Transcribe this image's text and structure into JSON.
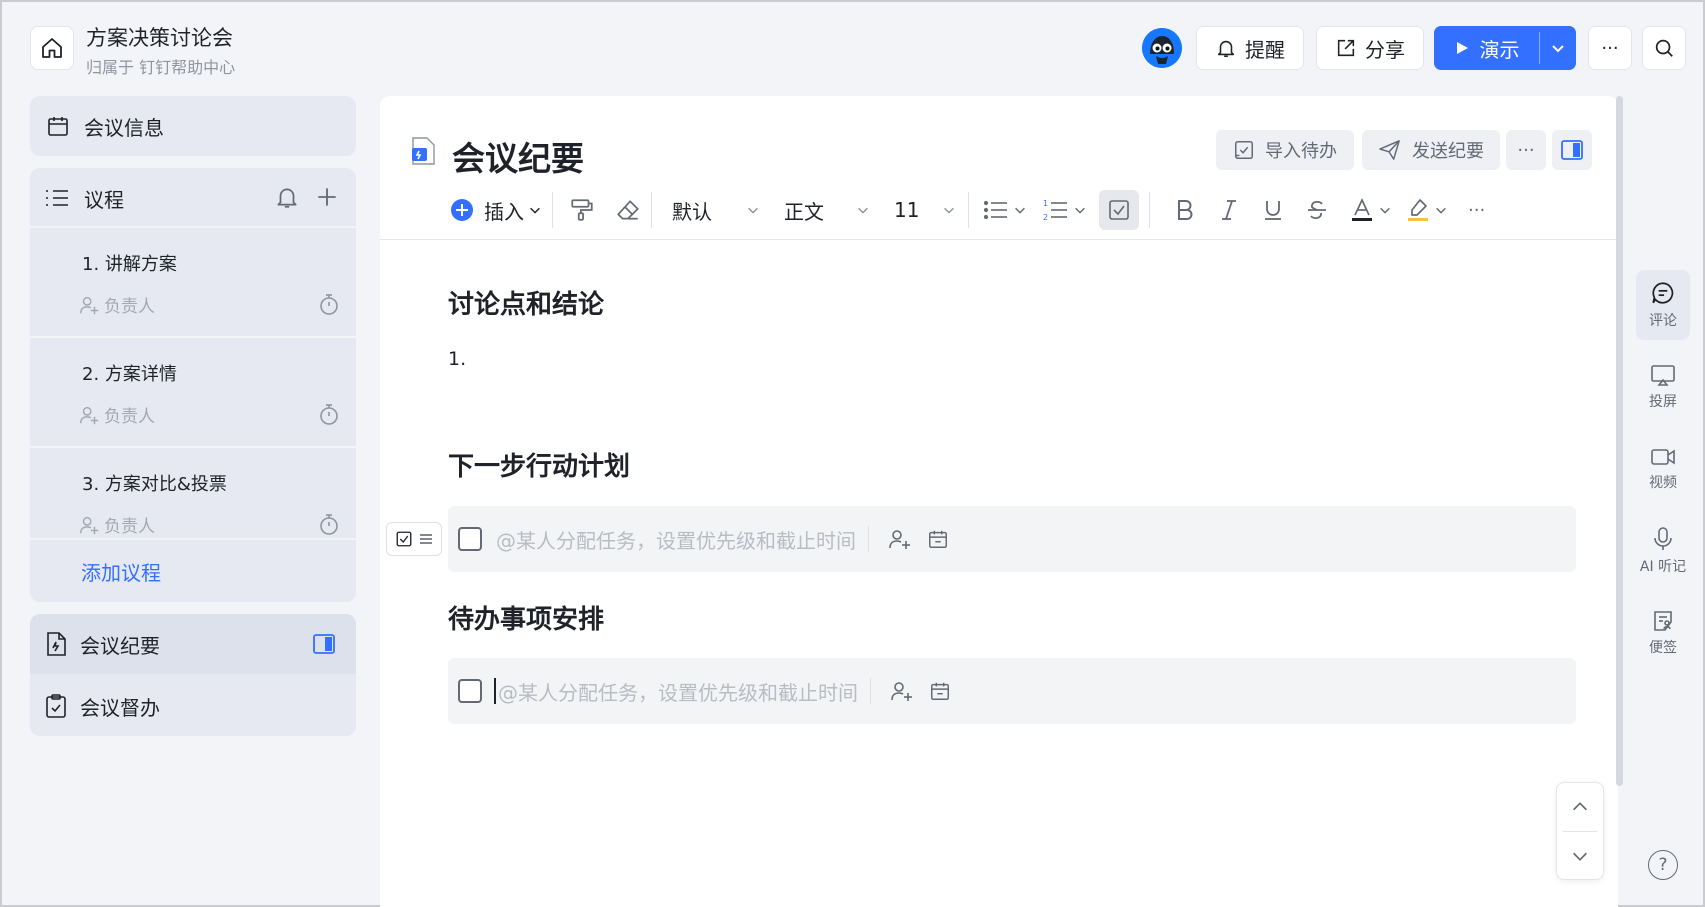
{
  "header": {
    "title": "方案决策讨论会",
    "subtitle": "归属于 钉钉帮助中心",
    "remind_label": "提醒",
    "share_label": "分享",
    "present_label": "演示",
    "more_label": "···"
  },
  "sidebar": {
    "meeting_info_label": "会议信息",
    "agenda_label": "议程",
    "agenda_items": [
      {
        "title": "1. 讲解方案",
        "owner": "负责人"
      },
      {
        "title": "2. 方案详情",
        "owner": "负责人"
      },
      {
        "title": "3. 方案对比&投票",
        "owner": "负责人"
      }
    ],
    "add_agenda_label": "添加议程",
    "minutes_label": "会议纪要",
    "supervise_label": "会议督办"
  },
  "doc": {
    "title": "会议纪要",
    "import_todo_label": "导入待办",
    "send_minutes_label": "发送纪要",
    "more_label": "···",
    "toolbar": {
      "insert_label": "插入",
      "font_label": "默认",
      "style_label": "正文",
      "size_label": "11",
      "more_label": "···"
    },
    "sections": [
      {
        "heading": "讨论点和结论",
        "list_item": "1."
      },
      {
        "heading": "下一步行动计划"
      },
      {
        "heading": "待办事项安排"
      }
    ],
    "task_placeholder": "@某人分配任务，设置优先级和截止时间"
  },
  "right_panel": {
    "items": [
      "评论",
      "投屏",
      "视频",
      "AI 听记",
      "便签"
    ],
    "help_label": "?"
  },
  "colors": {
    "accent": "#3370ff",
    "link": "#3370ff",
    "sidebar_card": "#e6e9f1",
    "background": "#f3f4f8"
  }
}
